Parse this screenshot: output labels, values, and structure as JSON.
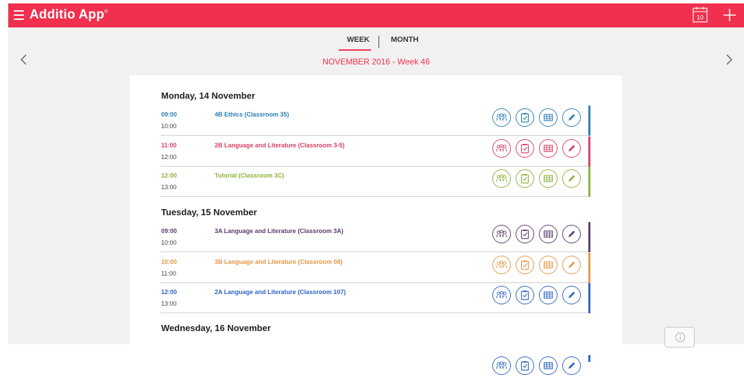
{
  "app": {
    "title": "Additio App",
    "reg_mark": "®",
    "calendar_day": "10"
  },
  "tabs": {
    "week": "WEEK",
    "month": "MONTH",
    "active": "WEEK"
  },
  "week_title": "NOVEMBER 2016 - Week 46",
  "colors": {
    "brand": "#f0304e",
    "blue": "#2c7eb0",
    "pink": "#d94064",
    "green": "#8cb23e",
    "purple": "#5b3d6e",
    "orange": "#e49846",
    "royal": "#2e66c4"
  },
  "days": [
    {
      "heading": "Monday, 14 November",
      "sessions": [
        {
          "start": "09:00",
          "end": "10:00",
          "subject": "4B Ethics (Classroom 35)",
          "color": "#2c7eb0"
        },
        {
          "start": "11:00",
          "end": "12:00",
          "subject": "2B Language and Literature (Classroom 3-5)",
          "color": "#d94064"
        },
        {
          "start": "12:00",
          "end": "13:00",
          "subject": "Tutorial (Classroom 3C)",
          "color": "#8cb23e"
        }
      ]
    },
    {
      "heading": "Tuesday, 15 November",
      "sessions": [
        {
          "start": "09:00",
          "end": "10:00",
          "subject": "3A Language and Literature (Classroom 3A)",
          "color": "#5b3d6e"
        },
        {
          "start": "10:00",
          "end": "11:00",
          "subject": "3B Language and Literature (Classroom 08)",
          "color": "#e49846"
        },
        {
          "start": "12:00",
          "end": "13:00",
          "subject": "2A Language and Literature (Classroom 107)",
          "color": "#2e66c4"
        }
      ]
    },
    {
      "heading": "Wednesday, 16 November",
      "sessions": [
        {
          "start": "",
          "end": "",
          "subject": "",
          "color": "#2e66c4"
        }
      ]
    }
  ],
  "session_icons": [
    "students-icon",
    "attendance-icon",
    "gradebook-icon",
    "edit-icon"
  ]
}
